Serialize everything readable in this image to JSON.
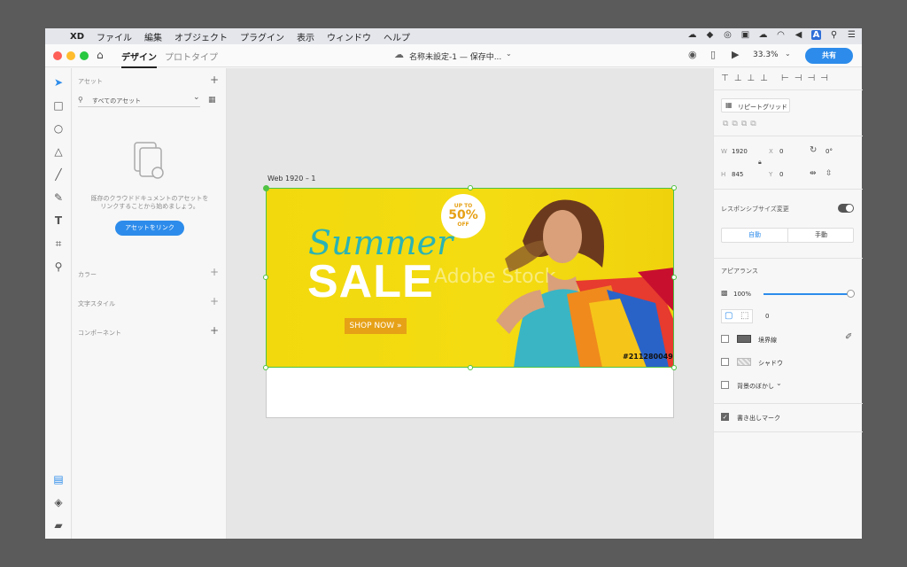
{
  "menubar": {
    "app": "XD",
    "items": [
      "ファイル",
      "編集",
      "オブジェクト",
      "プラグイン",
      "表示",
      "ウィンドウ",
      "ヘルプ"
    ]
  },
  "titlebar": {
    "tab_design": "デザイン",
    "tab_prototype": "プロトタイプ",
    "doc_title": "名称未設定-1 — 保存中...",
    "zoom": "33.3%",
    "share": "共有"
  },
  "assets": {
    "heading": "アセット",
    "filter": "すべてのアセット",
    "empty_text_1": "既存のクラウドドキュメントのアセットを",
    "empty_text_2": "リンクすることから始めましょう。",
    "link_button": "アセットをリンク",
    "colors": "カラー",
    "char_styles": "文字スタイル",
    "components": "コンポーネント"
  },
  "artboard": {
    "label": "Web 1920 – 1",
    "banner": {
      "script": "Summer",
      "title": "SALE",
      "cta": "SHOP NOW »",
      "badge_top": "UP TO",
      "badge_pct": "50%",
      "badge_off": "OFF",
      "stock_id": "#211280049",
      "watermark": "Adobe Stock"
    }
  },
  "props": {
    "repeat_grid": "リピートグリッド",
    "w_label": "W",
    "w": "1920",
    "x_label": "X",
    "x": "0",
    "h_label": "H",
    "h": "845",
    "y_label": "Y",
    "y": "0",
    "rotation": "0°",
    "responsive": "レスポンシブサイズ変更",
    "auto": "自動",
    "manual": "手動",
    "appearance": "アピアランス",
    "opacity": "100%",
    "corner": "0",
    "border": "境界線",
    "shadow": "シャドウ",
    "bg_blur": "背景のぼかし",
    "export_mark": "書き出しマーク"
  },
  "colors": {
    "accent": "#2d8ceb",
    "banner_yellow": "#f2d90f",
    "teal": "#2bb3b3",
    "cta": "#e6a117"
  }
}
